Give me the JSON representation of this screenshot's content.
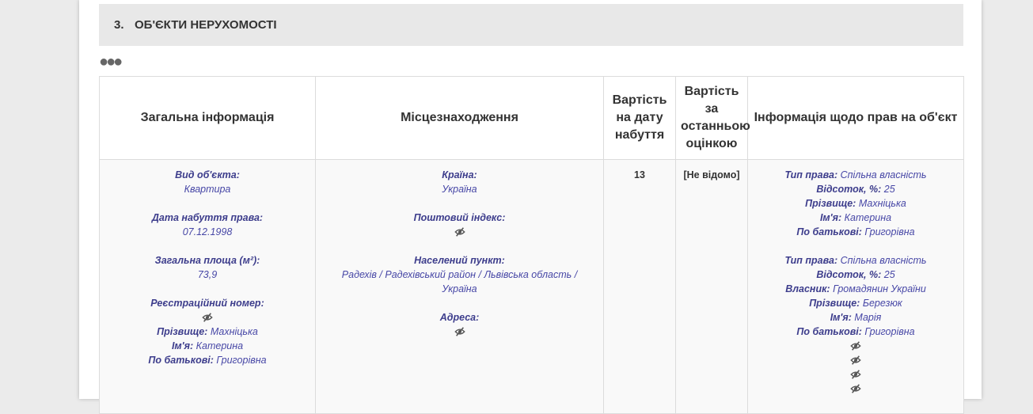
{
  "section": {
    "number": "3.",
    "title": "ОБ'ЄКТИ НЕРУХОМОСТІ"
  },
  "more_icon": "more-dots-icon",
  "table": {
    "headers": [
      "Загальна інформація",
      "Місцезнаходження",
      "Вартість на дату набуття",
      "Вартість за останньою оцінкою",
      "Інформація щодо прав на об'єкт"
    ],
    "row": {
      "general": {
        "object_type_label": "Вид об'єкта:",
        "object_type": "Квартира",
        "acq_date_label": "Дата набуття права:",
        "acq_date": "07.12.1998",
        "area_label": "Загальна площа (м²):",
        "area": "73,9",
        "reg_label": "Реєстраційний номер:",
        "surname_label": "Прізвище:",
        "surname": "Махніцька",
        "name_label": "Ім'я:",
        "name": "Катерина",
        "patronymic_label": "По батькові:",
        "patronymic": "Григорівна"
      },
      "location": {
        "country_label": "Країна:",
        "country": "Україна",
        "postal_label": "Поштовий індекс:",
        "settlement_label": "Населений пункт:",
        "settlement": "Радехів / Радехівський район / Львівська область / Україна",
        "address_label": "Адреса:"
      },
      "cost_acq": "13",
      "cost_last": "[Не відомо]",
      "rights": [
        {
          "type_label": "Тип права:",
          "type": "Спільна власність",
          "share_label": "Відсоток, %:",
          "share": "25",
          "surname_label": "Прізвище:",
          "surname": "Махніцька",
          "name_label": "Ім'я:",
          "name": "Катерина",
          "patronymic_label": "По батькові:",
          "patronymic": "Григорівна"
        },
        {
          "type_label": "Тип права:",
          "type": "Спільна власність",
          "share_label": "Відсоток, %:",
          "share": "25",
          "owner_label": "Власник:",
          "owner": "Громадянин України",
          "surname_label": "Прізвище:",
          "surname": "Березюк",
          "name_label": "Ім'я:",
          "name": "Марія",
          "patronymic_label": "По батькові:",
          "patronymic": "Григорівна"
        }
      ]
    }
  },
  "hidden_icon": "eye-slash-icon"
}
